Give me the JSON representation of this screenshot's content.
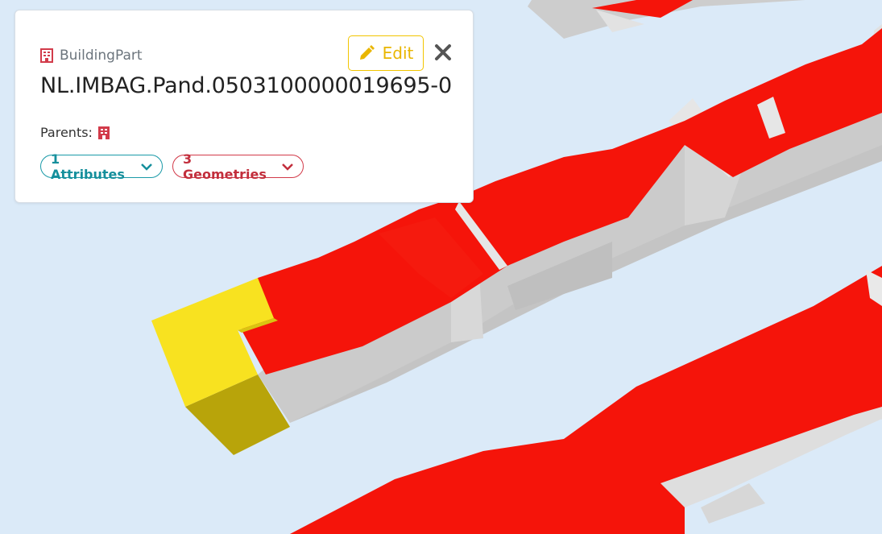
{
  "viewer": {
    "background_color": "#dbeaf8",
    "roof_color": "#f5140a",
    "wall_color": "#c4c4c4",
    "selected_roof_color": "#f9e21f",
    "selected_wall_color": "#b7a50a"
  },
  "info_card": {
    "type_icon": "building-icon",
    "type_label": "BuildingPart",
    "object_id": "NL.IMBAG.Pand.0503100000019695-0",
    "edit_label": "Edit",
    "close_icon": "close-icon",
    "parents_label": "Parents:",
    "parent_icon": "building-icon",
    "attributes_label": "1 Attributes",
    "geometries_label": "3 Geometries",
    "colors": {
      "edit": "#f2c500",
      "attributes": "#1a9aa8",
      "geometries": "#d23b4a"
    }
  }
}
